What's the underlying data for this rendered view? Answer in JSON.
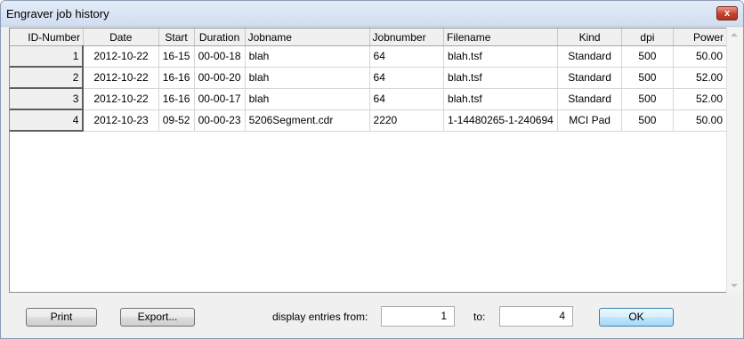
{
  "window": {
    "title": "Engraver job history",
    "close_label": "x"
  },
  "table": {
    "columns": [
      "ID-Number",
      "Date",
      "Start",
      "Duration",
      "Jobname",
      "Jobnumber",
      "Filename",
      "Kind",
      "dpi",
      "Power"
    ],
    "rows": [
      [
        "1",
        "2012-10-22",
        "16-15",
        "00-00-18",
        "blah",
        "64",
        "blah.tsf",
        "Standard",
        "500",
        "50.00"
      ],
      [
        "2",
        "2012-10-22",
        "16-16",
        "00-00-20",
        "blah",
        "64",
        "blah.tsf",
        "Standard",
        "500",
        "52.00"
      ],
      [
        "3",
        "2012-10-22",
        "16-16",
        "00-00-17",
        "blah",
        "64",
        "blah.tsf",
        "Standard",
        "500",
        "52.00"
      ],
      [
        "4",
        "2012-10-23",
        "09-52",
        "00-00-23",
        "5206Segment.cdr",
        "2220",
        "1-14480265-1-240694",
        "MCI Pad",
        "500",
        "50.00"
      ]
    ]
  },
  "footer": {
    "print_label": "Print",
    "export_label": "Export...",
    "range_label": "display entries from:",
    "from_value": "1",
    "to_label": "to:",
    "to_value": "4",
    "ok_label": "OK"
  }
}
